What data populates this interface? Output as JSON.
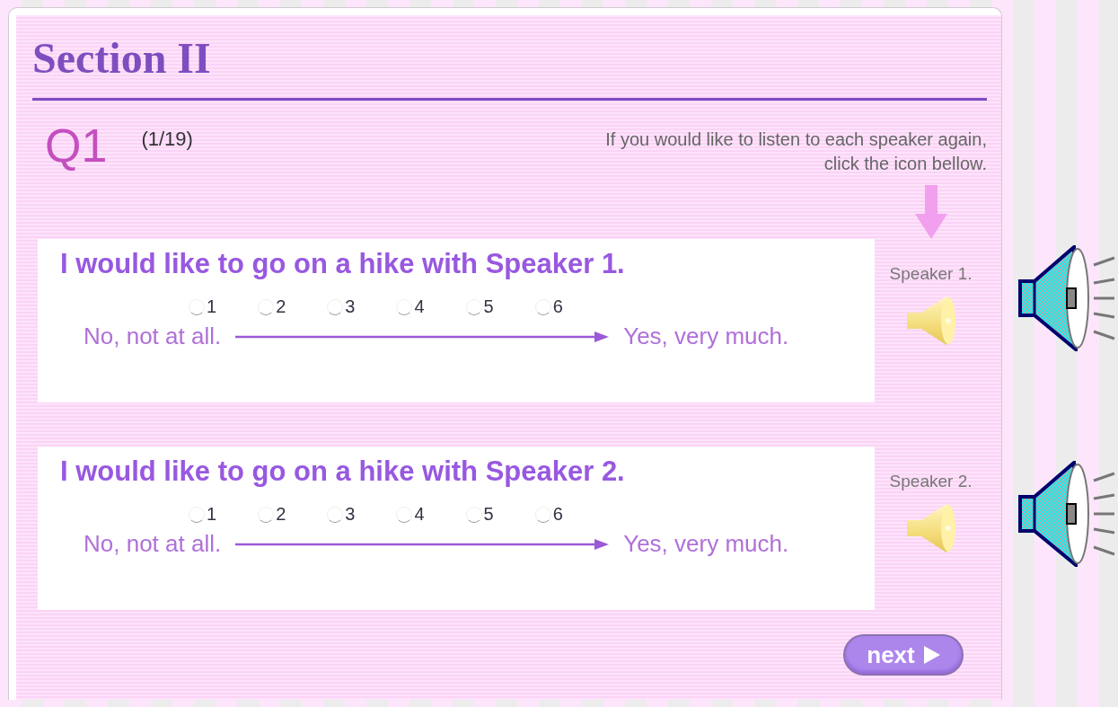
{
  "section_title": "Section II",
  "question": {
    "number": "Q1",
    "progress": "(1/19)"
  },
  "instruction": "If you would like to listen to each speaker again, click the icon bellow.",
  "items": [
    {
      "statement": "I would like to go on a hike with Speaker 1.",
      "speaker_label": "Speaker 1.",
      "low_label": "No, not at all.",
      "high_label": "Yes, very much.",
      "options": [
        {
          "label": "1",
          "selected": false
        },
        {
          "label": "2",
          "selected": false
        },
        {
          "label": "3",
          "selected": false
        },
        {
          "label": "4",
          "selected": false
        },
        {
          "label": "5",
          "selected": false
        },
        {
          "label": "6",
          "selected": false
        }
      ]
    },
    {
      "statement": "I would like to go on a hike with Speaker 2.",
      "speaker_label": "Speaker 2.",
      "low_label": "No, not at all.",
      "high_label": "Yes, very much.",
      "options": [
        {
          "label": "1",
          "selected": false
        },
        {
          "label": "2",
          "selected": false
        },
        {
          "label": "3",
          "selected": false
        },
        {
          "label": "4",
          "selected": false
        },
        {
          "label": "5",
          "selected": false
        },
        {
          "label": "6",
          "selected": false
        }
      ]
    }
  ],
  "next_button": "next"
}
